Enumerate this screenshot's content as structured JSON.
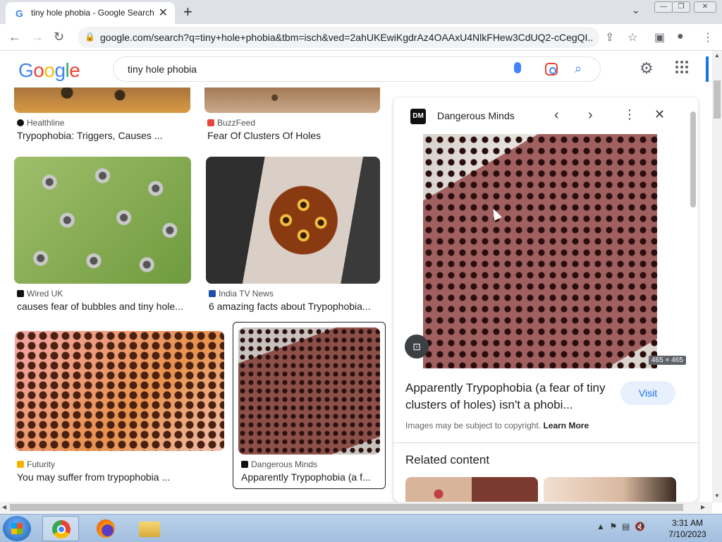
{
  "browser": {
    "tab_title": "tiny hole phobia - Google Search",
    "tab_favicon": "G",
    "url": "google.com/search?q=tiny+hole+phobia&tbm=isch&ved=2ahUKEwiKgdrAz4OAAxU4NlkFHew3CdUQ2-cCegQI...",
    "new_tab": "+",
    "close_tab": "✕"
  },
  "google": {
    "logo": "Google",
    "query": "tiny hole phobia"
  },
  "results": [
    {
      "source": "Healthline",
      "caption": "Trypophobia: Triggers, Causes ..."
    },
    {
      "source": "BuzzFeed",
      "caption": "Fear Of Clusters Of Holes"
    },
    {
      "source": "Wired UK",
      "caption": "causes fear of bubbles and tiny hole..."
    },
    {
      "source": "India TV News",
      "caption": "6 amazing facts about Trypophobia..."
    },
    {
      "source": "Futurity",
      "caption": "You may suffer from trypophobia ..."
    },
    {
      "source": "Dangerous Minds",
      "caption": "Apparently Trypophobia (a f..."
    }
  ],
  "panel": {
    "source_logo": "DM",
    "source": "Dangerous Minds",
    "dimensions": "465 × 465",
    "title": "Apparently Trypophobia (a fear of tiny clusters of holes) isn't a phobi...",
    "visit": "Visit",
    "copyright": "Images may be subject to copyright.",
    "learn_more": "Learn More",
    "related": "Related content"
  },
  "taskbar": {
    "time": "3:31 AM",
    "date": "7/10/2023"
  },
  "colors": {
    "google_blue": "#4285f4",
    "google_red": "#ea4335",
    "google_yellow": "#fbbc05",
    "google_green": "#34a853",
    "link_blue": "#1a73e8"
  }
}
